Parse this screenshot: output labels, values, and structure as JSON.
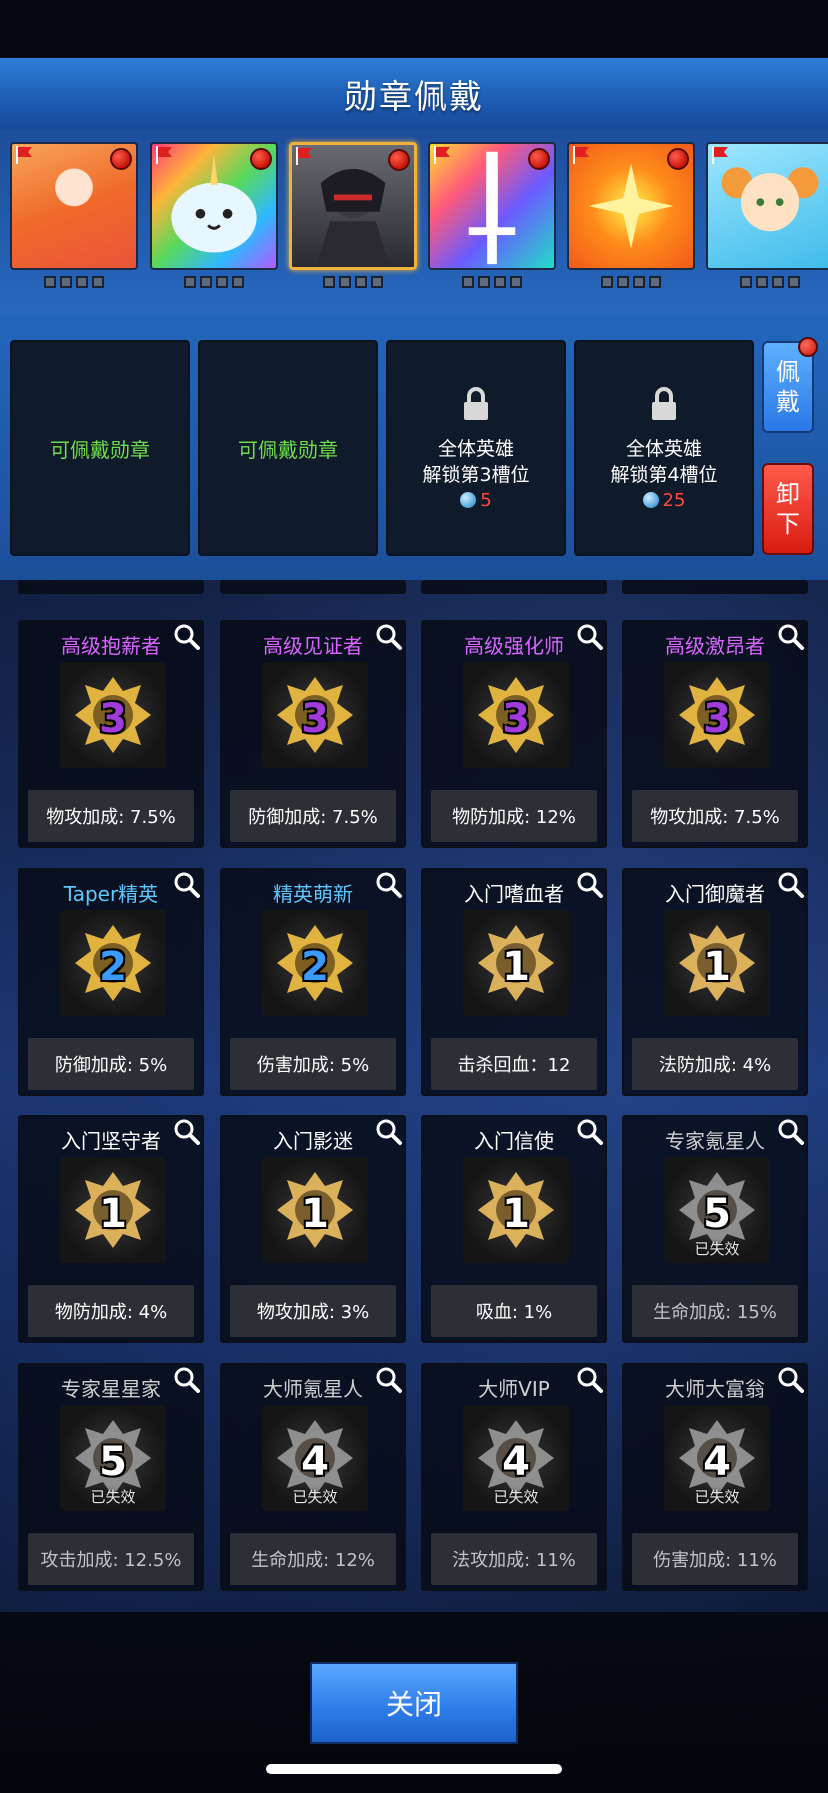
{
  "header": {
    "title": "勋章佩戴"
  },
  "heroes": [
    {
      "portrait": "blue-hair-girl",
      "selected": false
    },
    {
      "portrait": "rainbow-narwhal",
      "selected": false
    },
    {
      "portrait": "dark-knight",
      "selected": true
    },
    {
      "portrait": "white-sword",
      "selected": false
    },
    {
      "portrait": "golden-star",
      "selected": false
    },
    {
      "portrait": "orange-hair-doll",
      "selected": false
    }
  ],
  "equip_slots": [
    {
      "label": "可佩戴勋章"
    },
    {
      "label": "可佩戴勋章"
    },
    {
      "line1": "全体英雄",
      "line2": "解锁第3槽位",
      "cost": "5"
    },
    {
      "line1": "全体英雄",
      "line2": "解锁第4槽位",
      "cost": "25"
    }
  ],
  "side_buttons": {
    "wear": "佩戴",
    "remove": "卸下"
  },
  "medals": [
    {
      "name": "高级抱薪者",
      "level": "3",
      "bonus": "物攻加成: 7.5%",
      "name_color": "#d966ff",
      "expired": ""
    },
    {
      "name": "高级见证者",
      "level": "3",
      "bonus": "防御加成: 7.5%",
      "name_color": "#d966ff",
      "expired": ""
    },
    {
      "name": "高级强化师",
      "level": "3",
      "bonus": "物防加成: 12%",
      "name_color": "#d966ff",
      "expired": ""
    },
    {
      "name": "高级激昂者",
      "level": "3",
      "bonus": "物攻加成: 7.5%",
      "name_color": "#d966ff",
      "expired": ""
    },
    {
      "name": "Taper精英",
      "level": "2",
      "bonus": "防御加成: 5%",
      "name_color": "#5fc8ff",
      "expired": ""
    },
    {
      "name": "精英萌新",
      "level": "2",
      "bonus": "伤害加成: 5%",
      "name_color": "#5fc8ff",
      "expired": ""
    },
    {
      "name": "入门嗜血者",
      "level": "1",
      "bonus": "击杀回血：12",
      "name_color": "#ffffff",
      "expired": ""
    },
    {
      "name": "入门御魔者",
      "level": "1",
      "bonus": "法防加成: 4%",
      "name_color": "#ffffff",
      "expired": ""
    },
    {
      "name": "入门坚守者",
      "level": "1",
      "bonus": "物防加成: 4%",
      "name_color": "#ffffff",
      "expired": ""
    },
    {
      "name": "入门影迷",
      "level": "1",
      "bonus": "物攻加成: 3%",
      "name_color": "#ffffff",
      "expired": ""
    },
    {
      "name": "入门信使",
      "level": "1",
      "bonus": "吸血: 1%",
      "name_color": "#ffffff",
      "expired": ""
    },
    {
      "name": "专家氪星人",
      "level": "5",
      "bonus": "生命加成: 15%",
      "name_color": "#cfcfcf",
      "expired": "已失效"
    },
    {
      "name": "专家星星家",
      "level": "5",
      "bonus": "攻击加成: 12.5%",
      "name_color": "#cfcfcf",
      "expired": "已失效"
    },
    {
      "name": "大师氪星人",
      "level": "4",
      "bonus": "生命加成: 12%",
      "name_color": "#cfcfcf",
      "expired": "已失效"
    },
    {
      "name": "大师VIP",
      "level": "4",
      "bonus": "法攻加成: 11%",
      "name_color": "#cfcfcf",
      "expired": "已失效"
    },
    {
      "name": "大师大富翁",
      "level": "4",
      "bonus": "伤害加成: 11%",
      "name_color": "#cfcfcf",
      "expired": "已失效"
    }
  ],
  "footer": {
    "close_label": "关闭"
  },
  "colors": {
    "accent_blue": "#2d7ae8",
    "danger_red": "#d81d12",
    "equip_green": "#6fdc4a",
    "cost_red": "#ff4a3a",
    "selected_gold": "#f0b23a"
  }
}
